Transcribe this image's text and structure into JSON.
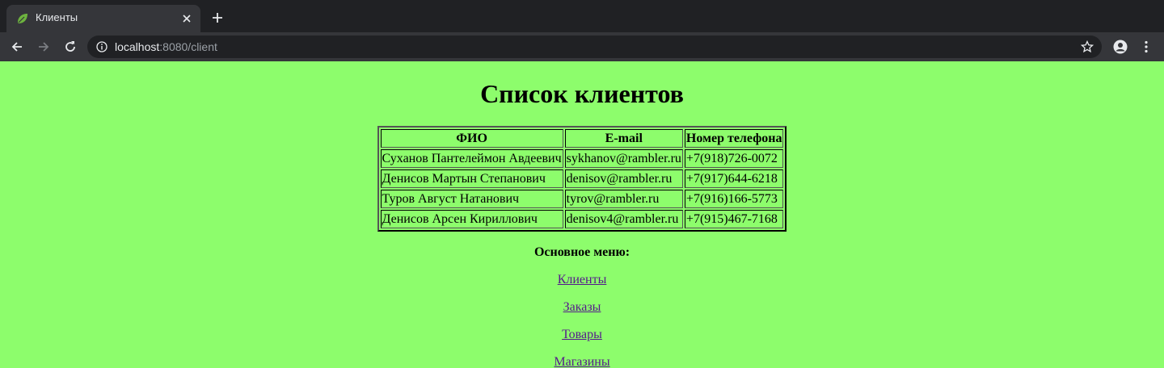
{
  "browser": {
    "tab_title": "Клиенты",
    "url_host": "localhost",
    "url_rest": ":8080/client"
  },
  "page": {
    "heading": "Список клиентов",
    "table": {
      "headers": [
        "ФИО",
        "E-mail",
        "Номер телефона"
      ],
      "rows": [
        [
          "Суханов Пантелеймон Авдеевич",
          "sykhanov@rambler.ru",
          "+7(918)726-0072"
        ],
        [
          "Денисов Мартын Степанович",
          "denisov@rambler.ru",
          "+7(917)644-6218"
        ],
        [
          "Туров Август Натанович",
          "tyrov@rambler.ru",
          "+7(916)166-5773"
        ],
        [
          "Денисов Арсен Кириллович",
          "denisov4@rambler.ru",
          "+7(915)467-7168"
        ]
      ]
    },
    "menu": {
      "title": "Основное меню:",
      "links": [
        "Клиенты",
        "Заказы",
        "Товары",
        "Магазины"
      ]
    }
  },
  "colors": {
    "page_background": "#8dfd6c",
    "link": "#551a8b"
  }
}
